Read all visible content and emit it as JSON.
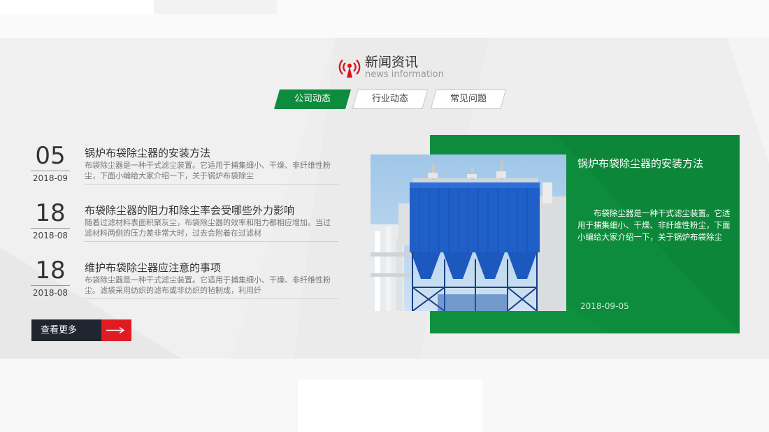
{
  "heading": {
    "title_cn": "新闻资讯",
    "title_en": "news information",
    "icon": "radio-tower-icon"
  },
  "tabs": [
    {
      "label": "公司动态",
      "active": true
    },
    {
      "label": "行业动态",
      "active": false
    },
    {
      "label": "常见问题",
      "active": false
    }
  ],
  "news": [
    {
      "day": "05",
      "year_month": "2018-09",
      "title": "锅炉布袋除尘器的安装方法",
      "desc": "布袋除尘器是一种干式滤尘装置。它适用于捕集细小、干燥、非纤维性粉尘，下面小编给大家介绍一下，关于锅炉布袋除尘"
    },
    {
      "day": "18",
      "year_month": "2018-08",
      "title": "布袋除尘器的阻力和除尘率会受哪些外力影响",
      "desc": "随着过滤材料表面积聚灰尘，布袋除尘器的效率和阻力都相应增加。当过滤材料两侧的压力差非常大时，过去会附着在过滤材"
    },
    {
      "day": "18",
      "year_month": "2018-08",
      "title": "维护布袋除尘器应注意的事项",
      "desc": "布袋除尘器是一种干式滤尘装置。它适用于捕集细小、干燥、非纤维性粉尘。滤袋采用纺织的滤布或非纺织的毡制成，利用纤"
    }
  ],
  "more_button": {
    "label": "查看更多",
    "icon": "arrow-right-icon"
  },
  "featured": {
    "title": "锅炉布袋除尘器的安装方法",
    "desc": "布袋除尘器是一种干式滤尘装置。它适用于捕集细小、干燥、非纤维性粉尘，下面小编给大家介绍一下，关于锅炉布袋除尘",
    "date": "2018-09-05",
    "image": "baghouse-dust-collector-photo"
  },
  "colors": {
    "brand_green": "#0e8c3d",
    "accent_red": "#e01b22",
    "dark": "#1f2630",
    "section_bg": "#efeeee"
  }
}
